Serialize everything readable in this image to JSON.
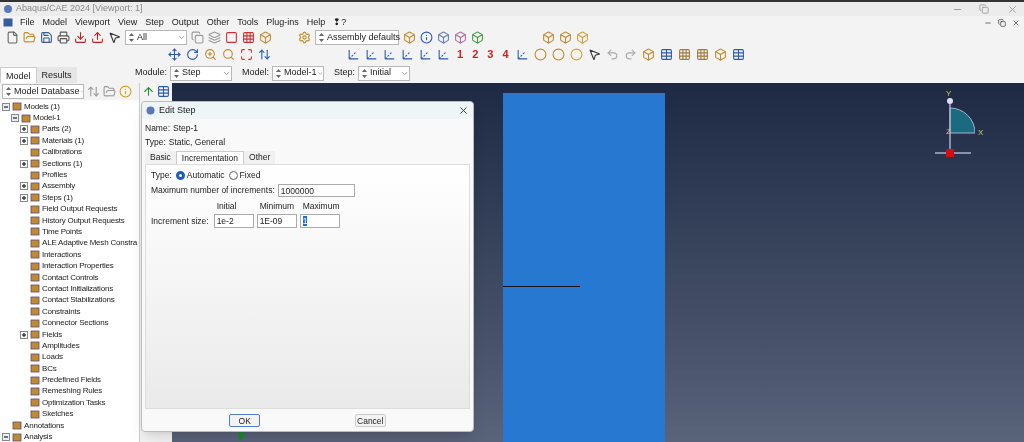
{
  "window": {
    "title": "Abaqus/CAE 2024 [Viewport: 1]"
  },
  "menu": [
    "File",
    "Model",
    "Viewport",
    "View",
    "Step",
    "Output",
    "Other",
    "Tools",
    "Plug-ins",
    "Help",
    "❢?"
  ],
  "toolbar": {
    "selection_filter": "All",
    "render_style": "Assembly defaults",
    "view_numbers": [
      "1",
      "2",
      "3",
      "4"
    ]
  },
  "context_bar": {
    "tabs": [
      {
        "label": "Model",
        "selected": true
      },
      {
        "label": "Results",
        "selected": false
      }
    ],
    "fields": [
      {
        "label": "Module:",
        "value": "Step"
      },
      {
        "label": "Model:",
        "value": "Model-1"
      },
      {
        "label": "Step:",
        "value": "Initial"
      }
    ]
  },
  "tree_source": "Model Database",
  "tree": [
    {
      "label": "Models (1)",
      "expanded": true,
      "children": [
        {
          "label": "Model-1",
          "expanded": true,
          "children": [
            {
              "label": "Parts (2)",
              "expanded": false
            },
            {
              "label": "Materials (1)",
              "expanded": false
            },
            {
              "label": "Calibrations"
            },
            {
              "label": "Sections (1)",
              "expanded": false
            },
            {
              "label": "Profiles"
            },
            {
              "label": "Assembly",
              "expanded": false
            },
            {
              "label": "Steps (1)",
              "expanded": false
            },
            {
              "label": "Field Output Requests"
            },
            {
              "label": "History Output Requests"
            },
            {
              "label": "Time Points"
            },
            {
              "label": "ALE Adaptive Mesh Constra"
            },
            {
              "label": "Interactions"
            },
            {
              "label": "Interaction Properties"
            },
            {
              "label": "Contact Controls"
            },
            {
              "label": "Contact Initializations"
            },
            {
              "label": "Contact Stabilizations"
            },
            {
              "label": "Constraints"
            },
            {
              "label": "Connector Sections"
            },
            {
              "label": "Fields",
              "expanded": false
            },
            {
              "label": "Amplitudes"
            },
            {
              "label": "Loads"
            },
            {
              "label": "BCs"
            },
            {
              "label": "Predefined Fields"
            },
            {
              "label": "Remeshing Rules"
            },
            {
              "label": "Optimization Tasks"
            },
            {
              "label": "Sketches"
            }
          ]
        }
      ]
    },
    {
      "label": "Annotations"
    },
    {
      "label": "Analysis",
      "expanded": true
    }
  ],
  "dialog": {
    "title": "Edit Step",
    "name_label": "Name:",
    "name": "Step-1",
    "type_label": "Type:",
    "type": "Static, General",
    "tabs": [
      {
        "label": "Basic",
        "selected": false
      },
      {
        "label": "Incrementation",
        "selected": true
      },
      {
        "label": "Other",
        "selected": false
      }
    ],
    "increment_type": {
      "label": "Type:",
      "options": [
        {
          "label": "Automatic",
          "selected": true
        },
        {
          "label": "Fixed",
          "selected": false
        }
      ]
    },
    "max_increments": {
      "label": "Maximum number of increments:",
      "value": "1000000"
    },
    "increment_size": {
      "label": "Increment size:",
      "fields": [
        {
          "heading": "Initial",
          "value": "1e-2",
          "highlighted": false
        },
        {
          "heading": "Minimum",
          "value": "1E-09",
          "highlighted": false
        },
        {
          "heading": "Maximum",
          "value": "1",
          "highlighted": true
        }
      ]
    },
    "buttons": [
      "OK",
      "Cancel"
    ]
  },
  "triad": {
    "y": "Y",
    "z": "Z",
    "x": "X"
  }
}
